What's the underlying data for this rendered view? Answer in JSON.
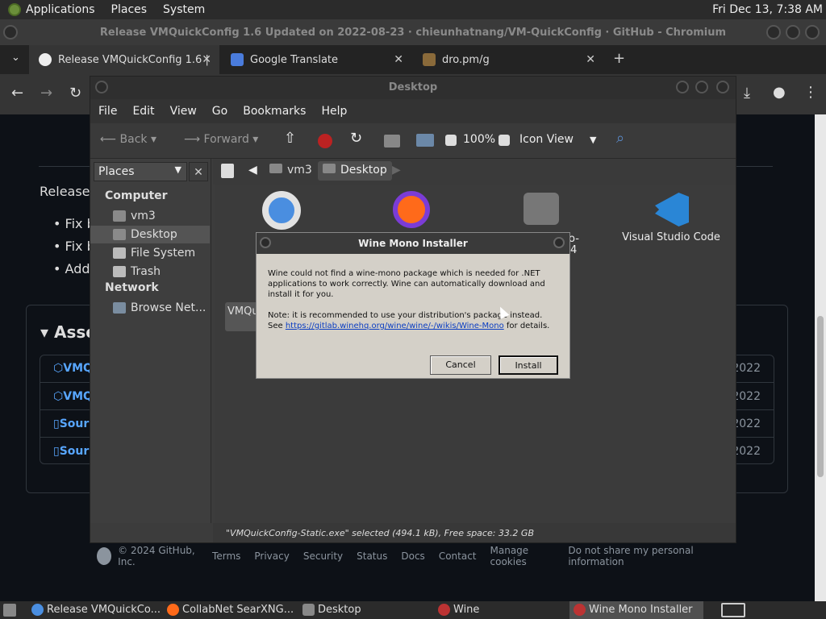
{
  "top_panel": {
    "menus": [
      "Applications",
      "Places",
      "System"
    ],
    "clock": "Fri Dec 13,  7:38 AM"
  },
  "chromium": {
    "title": "Release VMQuickConfig 1.6 Updated on 2022-08-23 · chieunhatnang/VM-QuickConfig · GitHub - Chromium",
    "tabs": [
      {
        "label": "Release VMQuickConfig 1.6 |"
      },
      {
        "label": "Google Translate"
      },
      {
        "label": "dro.pm/g"
      }
    ]
  },
  "github": {
    "release_text": "Release",
    "bullets": [
      "Fix b",
      "Fix b",
      "Add"
    ],
    "assets_heading": "Asse",
    "asset_rows": [
      {
        "name": "VMQ",
        "date": "2022"
      },
      {
        "name": "VMQ",
        "date": "2022"
      },
      {
        "name": "Sour",
        "date": "2022"
      },
      {
        "name": "Sour",
        "date": "2022"
      }
    ],
    "footer": {
      "copyright": "© 2024 GitHub, Inc.",
      "links": [
        "Terms",
        "Privacy",
        "Security",
        "Status",
        "Docs",
        "Contact",
        "Manage cookies",
        "Do not share my personal information"
      ]
    }
  },
  "file_manager": {
    "title": "Desktop",
    "menu": [
      "File",
      "Edit",
      "View",
      "Go",
      "Bookmarks",
      "Help"
    ],
    "toolbar": {
      "back": "Back",
      "forward": "Forward",
      "zoom": "100%",
      "view_mode": "Icon View"
    },
    "sidebar": {
      "combo": "Places",
      "computer_heading": "Computer",
      "computer_items": [
        "vm3",
        "Desktop",
        "File System",
        "Trash"
      ],
      "network_heading": "Network",
      "network_items": [
        "Browse Net..."
      ]
    },
    "path": [
      "vm3",
      "Desktop"
    ],
    "desktop_items": {
      "vscode": "Visual Studio Code",
      "video_partial": "eo-",
      "video_partial2": "p4",
      "vmq_partial": "VMQu"
    },
    "status": "\"VMQuickConfig-Static.exe\" selected (494.1 kB), Free space: 33.2 GB"
  },
  "wine_dialog": {
    "title": "Wine Mono Installer",
    "message": "Wine could not find a wine-mono package which is needed for .NET applications to work correctly. Wine can automatically download and install it for you.",
    "note_prefix": "Note: it is recommended to use your distribution's package instead. See",
    "link": "https://gitlab.winehq.org/wine/wine/-/wikis/Wine-Mono",
    "note_suffix": "for details.",
    "cancel": "Cancel",
    "install": "Install"
  },
  "taskbar": {
    "tasks": [
      "Release VMQuickCo...",
      "CollabNet SearXNG...",
      "Desktop",
      "Wine",
      "Wine Mono Installer"
    ]
  },
  "colors": {
    "github_bg": "#0d1117",
    "link_blue": "#58a6ff",
    "wine_face": "#d4d0c8"
  }
}
